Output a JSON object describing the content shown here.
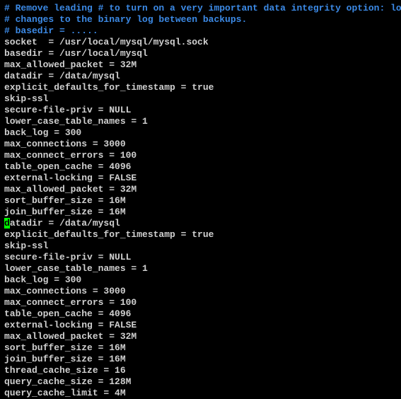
{
  "comments": {
    "c1": "# Remove leading # to turn on a very important data integrity option: logging",
    "c2": "# changes to the binary log between backups.",
    "c3": "# basedir = ....."
  },
  "lines": {
    "l1": "socket  = /usr/local/mysql/mysql.sock",
    "l2": "basedir = /usr/local/mysql",
    "l3": "max_allowed_packet = 32M",
    "l4": "datadir = /data/mysql",
    "l5": "explicit_defaults_for_timestamp = true",
    "l6": "skip-ssl",
    "l7": "secure-file-priv = NULL",
    "l8": "lower_case_table_names = 1",
    "l9": "back_log = 300",
    "l10": "max_connections = 3000",
    "l11": "max_connect_errors = 100",
    "l12": "table_open_cache = 4096",
    "l13": "external-locking = FALSE",
    "l14": "max_allowed_packet = 32M",
    "l15": "sort_buffer_size = 16M",
    "l16": "join_buffer_size = 16M",
    "cursor_char": "d",
    "l17_rest": "atadir = /data/mysql",
    "l18": "explicit_defaults_for_timestamp = true",
    "l19": "skip-ssl",
    "l20": "secure-file-priv = NULL",
    "l21": "lower_case_table_names = 1",
    "l22": "back_log = 300",
    "l23": "max_connections = 3000",
    "l24": "max_connect_errors = 100",
    "l25": "table_open_cache = 4096",
    "l26": "external-locking = FALSE",
    "l27": "max_allowed_packet = 32M",
    "l28": "sort_buffer_size = 16M",
    "l29": "join_buffer_size = 16M",
    "l30": "thread_cache_size = 16",
    "l31": "query_cache_size = 128M",
    "l32": "query_cache_limit = 4M"
  }
}
